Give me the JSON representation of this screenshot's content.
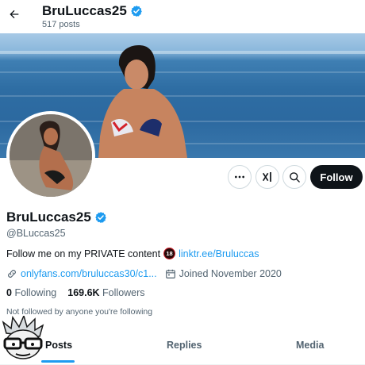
{
  "header": {
    "title": "BruLuccas25",
    "posts_count": "517 posts"
  },
  "profile": {
    "display_name": "BruLuccas25",
    "handle": "@BLuccas25",
    "bio_text": "Follow me on my PRIVATE content",
    "bio_badge": "18",
    "bio_link": "linktr.ee/Bruluccas",
    "website": "onlyfans.com/bruluccas30/c1...",
    "joined": "Joined November 2020",
    "following_count": "0",
    "following_label": "Following",
    "followers_count": "169.6K",
    "followers_label": "Followers",
    "not_followed_note": "Not followed by anyone you're following"
  },
  "actions": {
    "follow_label": "Follow",
    "grok_label": "x̸I"
  },
  "tabs": [
    {
      "label": "Posts",
      "active": true
    },
    {
      "label": "Replies",
      "active": false
    },
    {
      "label": "Media",
      "active": false
    }
  ],
  "icons": [
    "back-arrow-icon",
    "verified-icon",
    "more-icon",
    "grok-icon",
    "search-icon",
    "link-icon",
    "calendar-icon"
  ],
  "colors": {
    "accent": "#1d9bf0",
    "text": "#0f1419",
    "muted": "#536471",
    "follow_button": "#0f1419"
  }
}
